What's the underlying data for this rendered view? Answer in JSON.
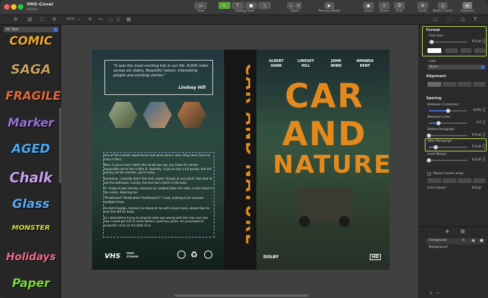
{
  "window": {
    "title": "VHS-Cover",
    "subtitle": "Edited"
  },
  "toolbar": {
    "view_label": "View",
    "editing_tools_label": "Editing Tools",
    "zoom_label": "Zoom",
    "preview_label": "Preview Mode",
    "insert_label": "Insert",
    "share_label": "Share",
    "print_label": "Print",
    "fonts_label": "Fonts",
    "media_tracks_label": "Media Tracks",
    "inspector_label": "Inspector",
    "zoom_value": "93%"
  },
  "sidebar": {
    "category": "2D Text",
    "presets": [
      {
        "label": "COMIC",
        "color": "#f0a830"
      },
      {
        "label": "SAGA",
        "color": "#c8a060"
      },
      {
        "label": "FRAGILE",
        "color": "#e06a3a"
      },
      {
        "label": "Marker",
        "color": "#9a70d8"
      },
      {
        "label": "AGED",
        "color": "#4aa8f0"
      },
      {
        "label": "Chalk",
        "color": "#c8a0f0"
      },
      {
        "label": "Glass",
        "color": "#5aa8f0"
      },
      {
        "label": "MONSTER",
        "color": "#d8e040"
      },
      {
        "label": "Holidays",
        "color": "#f06a8a"
      },
      {
        "label": "Paper",
        "color": "#7ad83a"
      }
    ]
  },
  "cover": {
    "quote": "\"It was the most exciting trip in our life. 8,000 miles across six states. Beautiful nature, interesting people and exciting stories.\"",
    "quote_author": "Lindsey Hill",
    "body_paragraphs": [
      "One of the craziest experiences took place when I was riding from Cuzco to Lima in Peru.",
      "Now, if you've ever ridden this windy bus leg, you know it's almost impossible not to feel a little ill. Honestly, if you're only a bit queasy and not puking out the window, you're lucky.",
      "Somehow, I actually didn't feel that unwell, though at one point I did need to use the bathroom. Luckily, this bus had a toilet in the back.",
      "Or maybe it was unlucky, because as I walked down the aisle, a man stood in the center, blocking me.",
      "\"Perdóname? Perdóname? Perdóname!?\" I said, seeking to be excused multiple times.",
      "He didn't budge, instead, he stared at me with vacant eyes, almost like his soul had left his body.",
      "As I stood there trying to pinpoint what was wrong with this man and also how I could get him to move before I peed my pants—he proceeded to projectile vomit on the both of us."
    ],
    "back_logo": "VHS",
    "back_logo_2": "WAVE STUDIOS",
    "spine_title": "CAR AND NATURE",
    "front_authors": [
      {
        "first": "ALBERT",
        "last": "DANK"
      },
      {
        "first": "LINDSEY",
        "last": "HILL"
      },
      {
        "first": "JOHN",
        "last": "WIND"
      },
      {
        "first": "AMANDA",
        "last": "KENT"
      }
    ],
    "front_title_lines": [
      "CAR",
      "AND",
      "NATURE"
    ],
    "dolby_label": "DOLBY",
    "hd_label": "HD"
  },
  "inspector": {
    "format_heading": "Format",
    "font_size_label": "Font Size",
    "font_size_value": "9,0 pt",
    "font_size_fraction": 0.08,
    "lists_label": "Lists",
    "lists_value": "None",
    "alignment_heading": "Alignment",
    "spacing_heading": "Spacing",
    "between_characters_label": "Between Characters",
    "between_characters_value": "0,0%",
    "between_characters_fraction": 0.5,
    "between_lines_label": "Between Lines",
    "between_lines_value": "1,0",
    "between_lines_fraction": 0.25,
    "before_paragraph_label": "Before Paragraph",
    "before_paragraph_value": "0,0 pt",
    "before_paragraph_fraction": 0.0,
    "after_paragraph_label": "After Paragraph",
    "after_paragraph_value": "5,0 pt",
    "after_paragraph_fraction": 0.18,
    "inset_margin_label": "Inset Margin",
    "inset_margin_value": "0,0 pt",
    "inset_margin_fraction": 0.0,
    "object_wrap_label": "Object causes wrap",
    "extra_space_label": "Extra Space",
    "extra_space_value": "0,0 pt",
    "layers": [
      {
        "label": "Foreground"
      },
      {
        "label": "Background"
      }
    ],
    "highlight_color": "#b7e25a",
    "accent_color": "#3a6fd8"
  }
}
